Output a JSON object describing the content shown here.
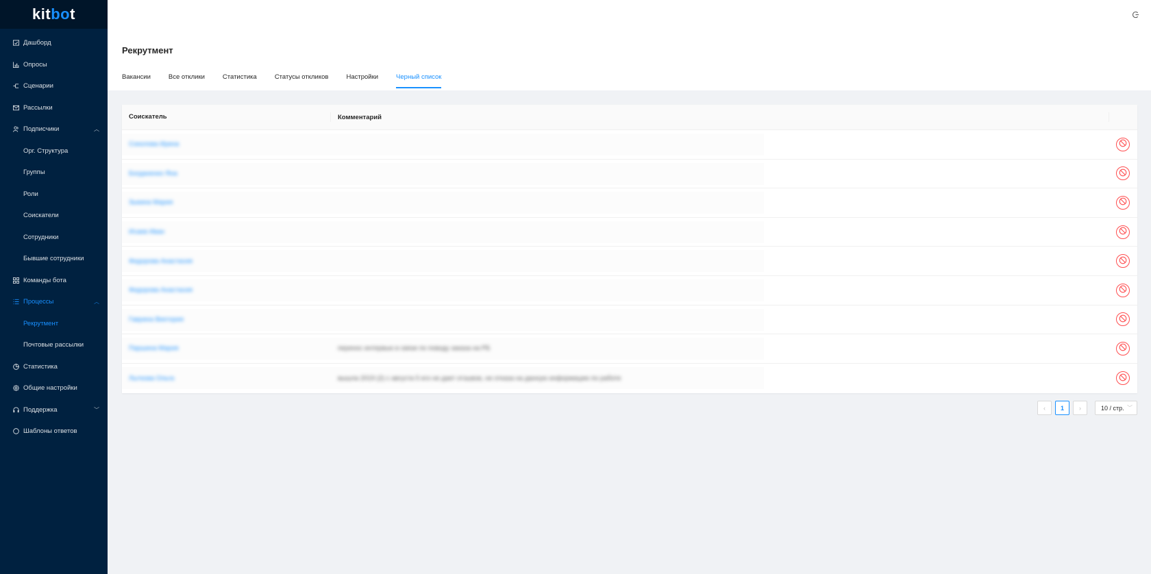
{
  "app": {
    "logo_prefix": "kit",
    "logo_accent": "bo",
    "logo_suffix": "t"
  },
  "sidebar": {
    "items": [
      {
        "label": "Дашборд",
        "icon": "dashboard-icon"
      },
      {
        "label": "Опросы",
        "icon": "chart-icon"
      },
      {
        "label": "Сценарии",
        "icon": "flow-icon"
      },
      {
        "label": "Рассылки",
        "icon": "mail-icon"
      },
      {
        "label": "Подписчики",
        "icon": "users-icon"
      },
      {
        "label": "Орг. Структура"
      },
      {
        "label": "Группы"
      },
      {
        "label": "Роли"
      },
      {
        "label": "Соискатели"
      },
      {
        "label": "Сотрудники"
      },
      {
        "label": "Бывшие сотрудники"
      },
      {
        "label": "Команды бота",
        "icon": "grid-icon"
      },
      {
        "label": "Процессы",
        "icon": "list-icon"
      },
      {
        "label": "Рекрутмент"
      },
      {
        "label": "Почтовые рассылки"
      },
      {
        "label": "Статистика",
        "icon": "pie-icon"
      },
      {
        "label": "Общие настройки",
        "icon": "gear-icon"
      },
      {
        "label": "Поддержка",
        "icon": "headset-icon"
      },
      {
        "label": "Шаблоны ответов",
        "icon": "template-icon"
      }
    ]
  },
  "header": {
    "icon": "logout-icon"
  },
  "page": {
    "title": "Рекрутмент",
    "tabs": [
      {
        "label": "Вакансии"
      },
      {
        "label": "Все отклики"
      },
      {
        "label": "Статистика"
      },
      {
        "label": "Статусы откликов"
      },
      {
        "label": "Настройки"
      },
      {
        "label": "Черный список"
      }
    ]
  },
  "table": {
    "headers": {
      "applicant": "Соискатель",
      "comment": "Комментарий"
    },
    "rows": [
      {
        "applicant": "Соколова Ирина",
        "comment": ""
      },
      {
        "applicant": "Богданенко Яна",
        "comment": ""
      },
      {
        "applicant": "Зыкина Мария",
        "comment": ""
      },
      {
        "applicant": "Исаев Иван",
        "comment": ""
      },
      {
        "applicant": "Федорова Анастасия",
        "comment": ""
      },
      {
        "applicant": "Федорова Анастасия",
        "comment": ""
      },
      {
        "applicant": "Гаврина Виктория",
        "comment": ""
      },
      {
        "applicant": "Паршина Мария",
        "comment": "перенос интервью в связи по поводу заказа на РБ"
      },
      {
        "applicant": "Лыткова Ольга",
        "comment": "вышла 2019 (2) с августа 5 его не дает отзывов, не отказа на данную информацию по работе"
      }
    ]
  },
  "pagination": {
    "prev": "‹",
    "current": "1",
    "next": "›",
    "page_size": "10 / стр."
  },
  "colors": {
    "sidebar_bg": "#002140",
    "logo_bg": "#001529",
    "accent": "#1890ff",
    "danger": "#ff4d4f"
  }
}
